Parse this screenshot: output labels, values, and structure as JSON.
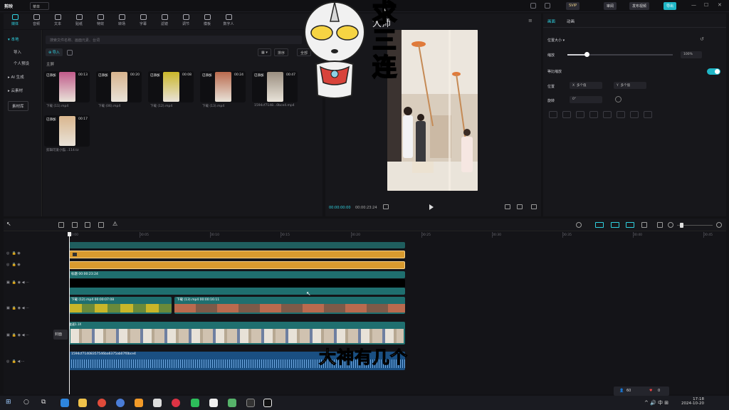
{
  "app": {
    "name": "剪映",
    "menu_label": "菜单",
    "title_overlay": "大师",
    "svip": "SVIP",
    "review": "审阅",
    "publish": "发布视频",
    "export": "导出"
  },
  "toolbar": {
    "items": [
      {
        "label": "媒体",
        "icon": "media-icon"
      },
      {
        "label": "音频",
        "icon": "audio-icon"
      },
      {
        "label": "文本",
        "icon": "text-icon"
      },
      {
        "label": "贴纸",
        "icon": "sticker-icon"
      },
      {
        "label": "特效",
        "icon": "effects-icon"
      },
      {
        "label": "转场",
        "icon": "transition-icon"
      },
      {
        "label": "字幕",
        "icon": "caption-icon"
      },
      {
        "label": "滤镜",
        "icon": "filter-icon"
      },
      {
        "label": "调节",
        "icon": "adjust-icon"
      },
      {
        "label": "模板",
        "icon": "template-icon"
      },
      {
        "label": "数字人",
        "icon": "avatar-icon"
      }
    ]
  },
  "sidenav": {
    "items": [
      "▾ 本地",
      "导入",
      "个人预设",
      "▸ AI 生成",
      "▸ 云素材",
      "素材库"
    ]
  },
  "media": {
    "search_placeholder": "搜索文件名称、画面元素、台词",
    "import_label": "导入",
    "sort_label": "排序",
    "filter_label": "全部",
    "section_label": "主屏",
    "clips": [
      {
        "tag": "已添加",
        "duration": "00:13",
        "name": "下载 (11).mp4",
        "color": "#c05a8a"
      },
      {
        "tag": "已添加",
        "duration": "00:20",
        "name": "下载 (06).mp4",
        "color": "#d7b38d"
      },
      {
        "tag": "已添加",
        "duration": "00:08",
        "name": "下载 (12).mp4",
        "color": "#c9b629"
      },
      {
        "tag": "已添加",
        "duration": "00:24",
        "name": "下载 (13).mp4",
        "color": "#b96a4e"
      },
      {
        "tag": "已添加",
        "duration": "00:47",
        "name": "1594cf7148...0bce4.mp4",
        "color": "#9a8e80"
      },
      {
        "tag": "已添加",
        "duration": "00:17",
        "name": "剪辑可爱小猫...114.tz",
        "color": "#d9b68e"
      }
    ]
  },
  "player": {
    "current_time": "00:00:00:00",
    "total_time": "00:00:23:24"
  },
  "inspector": {
    "tabs": [
      "画面",
      "动画"
    ],
    "section": "位置大小 ▾",
    "scale_label": "缩放",
    "scale_value": "100%",
    "scale_fraction": 0.18,
    "uniform_label": "等比缩放",
    "position_label": "位置",
    "pos_x": "多个值",
    "pos_y": "多个值",
    "rotate_label": "旋转",
    "rotate_value": "0°"
  },
  "timeline": {
    "ruler": [
      "00:00",
      "00:05",
      "00:10",
      "00:15",
      "00:20",
      "00:25",
      "00:30",
      "00:35",
      "00:40",
      "00:45"
    ],
    "cover_label": "封面",
    "text_track_label": "标题  00:00:23:24",
    "clip1_label": "下载 (12).mp4  00:00:07:08",
    "clip2_label": "下载 (13).mp4  00:00:16:11",
    "speed_label": "变速1.1X",
    "audio_label": "1594cf71408357546ba6375ab07f0bce4"
  },
  "overlay": {
    "stamp_text": [
      "求",
      "三",
      "连"
    ],
    "subtitle": "大神有几个"
  },
  "stats": {
    "viewers": "60",
    "likes": "0"
  },
  "taskbar": {
    "time": "17:18",
    "date": "2024-10-20"
  },
  "colors": {
    "accent": "#2fd1e0",
    "gold_track": "#d89a2e",
    "teal_track": "#1f6f6f"
  }
}
